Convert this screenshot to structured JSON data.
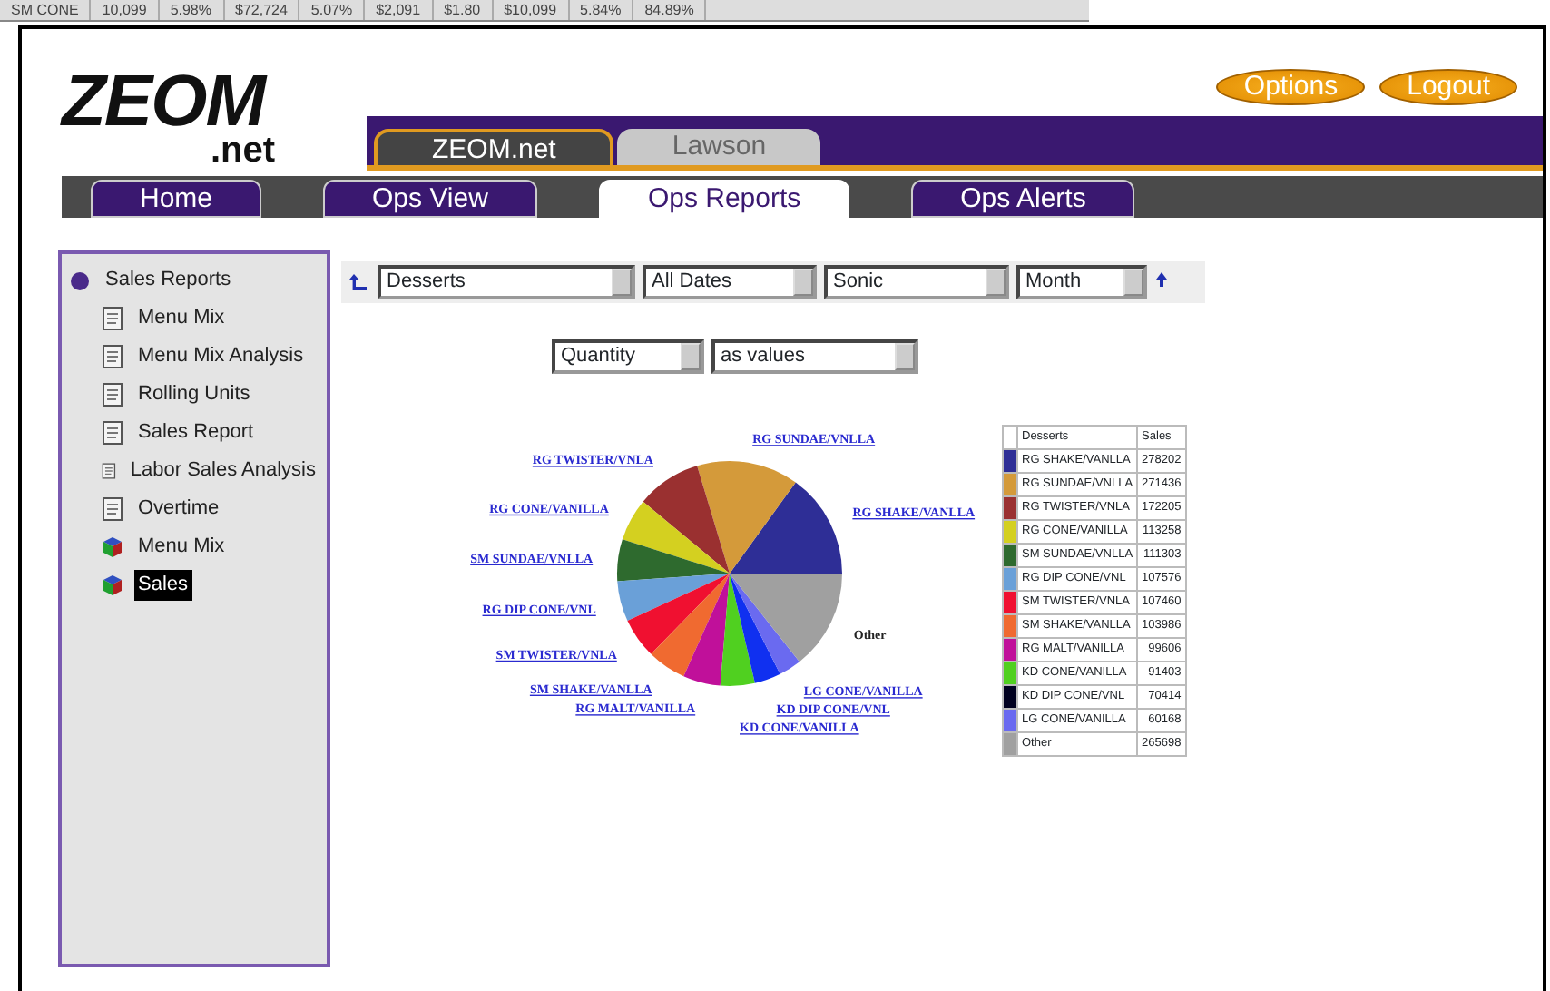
{
  "background_strip": {
    "cells": [
      "SM CONE",
      "10,099",
      "5.98%",
      "$72,724",
      "5.07%",
      "$2,091",
      "$1.80",
      "$10,099",
      "5.84%",
      "84.89%"
    ]
  },
  "header": {
    "logo": {
      "main": "ZEOM",
      "sub": ".net"
    },
    "top_buttons": [
      "Options",
      "Logout"
    ],
    "systems": [
      {
        "label": "ZEOM.net",
        "selected": true
      },
      {
        "label": "Lawson",
        "selected": false
      }
    ],
    "nav_tabs": [
      {
        "label": "Home",
        "selected": false
      },
      {
        "label": "Ops View",
        "selected": false
      },
      {
        "label": "Ops Reports",
        "selected": true
      },
      {
        "label": "Ops Alerts",
        "selected": false
      }
    ]
  },
  "sidebar": {
    "tree": [
      {
        "label": "Sales Reports",
        "kind": "folder",
        "selected": false,
        "children": [
          {
            "label": "Menu Mix",
            "kind": "report",
            "selected": false
          },
          {
            "label": "Menu Mix Analysis",
            "kind": "report",
            "selected": false
          },
          {
            "label": "Rolling Units",
            "kind": "report",
            "selected": false
          },
          {
            "label": "Sales Report",
            "kind": "report",
            "selected": false
          },
          {
            "label": "Labor Sales Analysis",
            "kind": "report",
            "selected": false
          },
          {
            "label": "Overtime",
            "kind": "report",
            "selected": false
          },
          {
            "label": "Menu Mix",
            "kind": "cube",
            "selected": false
          },
          {
            "label": "Sales",
            "kind": "cube",
            "selected": true
          }
        ]
      }
    ]
  },
  "filters": {
    "row_1": [
      {
        "value": "Desserts"
      },
      {
        "value": "All Dates"
      },
      {
        "value": "Sonic"
      },
      {
        "value": "Month"
      }
    ],
    "row_2": [
      {
        "value": "Quantity"
      },
      {
        "value": "as values"
      }
    ]
  },
  "report": {
    "chart_data": {
      "type": "pie",
      "categories": [
        "RG SHAKE/VANLLA",
        "RG SUNDAE/VNLLA",
        "RG TWISTER/VNLA",
        "RG CONE/VANILLA",
        "SM SUNDAE/VNLLA",
        "RG DIP CONE/VNL",
        "SM TWISTER/VNLA",
        "SM SHAKE/VANLLA",
        "RG MALT/VANILLA",
        "KD CONE/VANILLA",
        "KD DIP CONE/VNL",
        "LG CONE/VANILLA",
        "Other"
      ],
      "series": [
        {
          "values": [
            15.02,
            14.65,
            9.29,
            6.11,
            6.01,
            5.81,
            5.8,
            5.61,
            5.38,
            4.93,
            3.8,
            3.25,
            14.34
          ]
        }
      ],
      "colors": [
        "#2e2e96",
        "#d49a3a",
        "#9a3030",
        "#d4d020",
        "#2e6a2e",
        "#6aa0d8",
        "#f01030",
        "#f06a30",
        "#c0109a",
        "#50d020",
        "#1030f0",
        "#6a6af0",
        "#a0a0a0"
      ]
    },
    "legend": {
      "columns": [
        "Desserts",
        "Sales"
      ],
      "rows": [
        {
          "color": "#2e2e96",
          "name": "RG SHAKE/VANLLA",
          "sales": "278202"
        },
        {
          "color": "#d49a3a",
          "name": "RG SUNDAE/VNLLA",
          "sales": "271436"
        },
        {
          "color": "#9a3030",
          "name": "RG TWISTER/VNLA",
          "sales": "172205"
        },
        {
          "color": "#d4d020",
          "name": "RG CONE/VANILLA",
          "sales": "113258"
        },
        {
          "color": "#2e6a2e",
          "name": "SM SUNDAE/VNLLA",
          "sales": "111303"
        },
        {
          "color": "#6aa0d8",
          "name": "RG DIP CONE/VNL",
          "sales": "107576"
        },
        {
          "color": "#f01030",
          "name": "SM TWISTER/VNLA",
          "sales": "107460"
        },
        {
          "color": "#f06a30",
          "name": "SM SHAKE/VANLLA",
          "sales": "103986"
        },
        {
          "color": "#c0109a",
          "name": "RG MALT/VANILLA",
          "sales": "99606"
        },
        {
          "color": "#50d020",
          "name": "KD CONE/VANILLA",
          "sales": "91403"
        },
        {
          "color": "#000020",
          "name": "KD DIP CONE/VNL",
          "sales": "70414"
        },
        {
          "color": "#6a6af0",
          "name": "LG CONE/VANILLA",
          "sales": "60168"
        },
        {
          "color": "#a0a0a0",
          "name": "Other",
          "sales": "265698"
        }
      ]
    }
  }
}
